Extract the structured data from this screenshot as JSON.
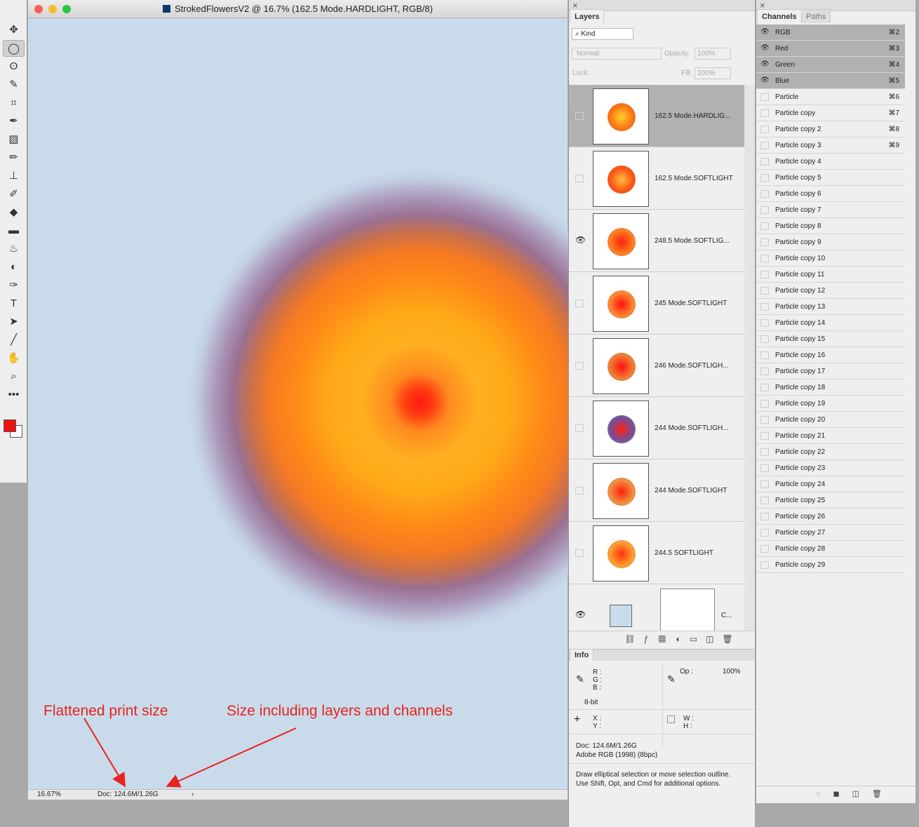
{
  "document": {
    "title": "StrokedFlowersV2 @ 16.7% (162.5 Mode.HARDLIGHT, RGB/8)",
    "zoom": "16.67%",
    "doc_size": "Doc: 124.6M/1.26G",
    "status_arrow": "›"
  },
  "toolbar": {
    "tools": [
      "move",
      "elliptical-marquee",
      "lasso",
      "quick-selection",
      "crop",
      "eyedropper",
      "healing-brush",
      "brush",
      "clone-stamp",
      "history-brush",
      "eraser",
      "gradient",
      "blur",
      "dodge",
      "pen",
      "type",
      "path-selection",
      "line",
      "hand",
      "zoom",
      "more"
    ],
    "foreground_color": "#ee1111",
    "background_color": "#ffffff"
  },
  "layers": {
    "tab": "Layers",
    "filter_kind": "Kind",
    "blend_mode": "Normal",
    "opacity_label": "Opacity:",
    "opacity": "100%",
    "lock_label": "Lock:",
    "fill_label": "Fill:",
    "fill": "100%",
    "items": [
      {
        "name": "162.5 Mode.HARDLIG...",
        "visible": false,
        "selected": true
      },
      {
        "name": "162.5 Mode.SOFTLIGHT",
        "visible": false,
        "selected": false
      },
      {
        "name": "248.5 Mode.SOFTLIG...",
        "visible": true,
        "selected": false
      },
      {
        "name": "245 Mode.SOFTLIGHT",
        "visible": false,
        "selected": false
      },
      {
        "name": "246 Mode.SOFTLIGH...",
        "visible": false,
        "selected": false
      },
      {
        "name": "244 Mode.SOFTLIGH...",
        "visible": false,
        "selected": false
      },
      {
        "name": "244 Mode.SOFTLIGHT",
        "visible": false,
        "selected": false
      },
      {
        "name": "244.5 SOFTLIGHT",
        "visible": false,
        "selected": false
      },
      {
        "name": "C...",
        "visible": true,
        "selected": false
      }
    ]
  },
  "info": {
    "tab": "Info",
    "r": "R :",
    "g": "G :",
    "b": "B :",
    "bit": "8-bit",
    "op_label": "Op :",
    "op": "100%",
    "x": "X :",
    "y": "Y :",
    "w": "W :",
    "h": "H :",
    "doc": "Doc: 124.6M/1.26G",
    "profile": "Adobe RGB (1998) (8bpc)",
    "hint1": "Draw elliptical selection or move selection outline.",
    "hint2": "Use Shift, Opt, and Cmd for additional options."
  },
  "channels": {
    "tabs": [
      "Channels",
      "Paths"
    ],
    "items": [
      {
        "name": "RGB",
        "shortcut": "⌘2",
        "visible": true
      },
      {
        "name": "Red",
        "shortcut": "⌘3",
        "visible": true
      },
      {
        "name": "Green",
        "shortcut": "⌘4",
        "visible": true
      },
      {
        "name": "Blue",
        "shortcut": "⌘5",
        "visible": true
      },
      {
        "name": "Particle",
        "shortcut": "⌘6"
      },
      {
        "name": "Particle copy",
        "shortcut": "⌘7"
      },
      {
        "name": "Particle copy 2",
        "shortcut": "⌘8"
      },
      {
        "name": "Particle copy 3",
        "shortcut": "⌘9"
      },
      {
        "name": "Particle copy 4"
      },
      {
        "name": "Particle copy 5"
      },
      {
        "name": "Particle copy 6"
      },
      {
        "name": "Particle copy 7"
      },
      {
        "name": "Particle copy 8"
      },
      {
        "name": "Particle copy 9"
      },
      {
        "name": "Particle copy 10"
      },
      {
        "name": "Particle copy 11"
      },
      {
        "name": "Particle copy 12"
      },
      {
        "name": "Particle copy 13"
      },
      {
        "name": "Particle copy 14"
      },
      {
        "name": "Particle copy 15"
      },
      {
        "name": "Particle copy 16"
      },
      {
        "name": "Particle copy 17"
      },
      {
        "name": "Particle copy 18"
      },
      {
        "name": "Particle copy 19"
      },
      {
        "name": "Particle copy 20"
      },
      {
        "name": "Particle copy 21"
      },
      {
        "name": "Particle copy 22"
      },
      {
        "name": "Particle copy 23"
      },
      {
        "name": "Particle copy 24"
      },
      {
        "name": "Particle copy 25"
      },
      {
        "name": "Particle copy 26"
      },
      {
        "name": "Particle copy 27"
      },
      {
        "name": "Particle copy 28"
      },
      {
        "name": "Particle copy 29"
      }
    ]
  },
  "annotations": {
    "left": "Flattened print size",
    "right": "Size including layers and channels",
    "color": "#e8231c"
  }
}
